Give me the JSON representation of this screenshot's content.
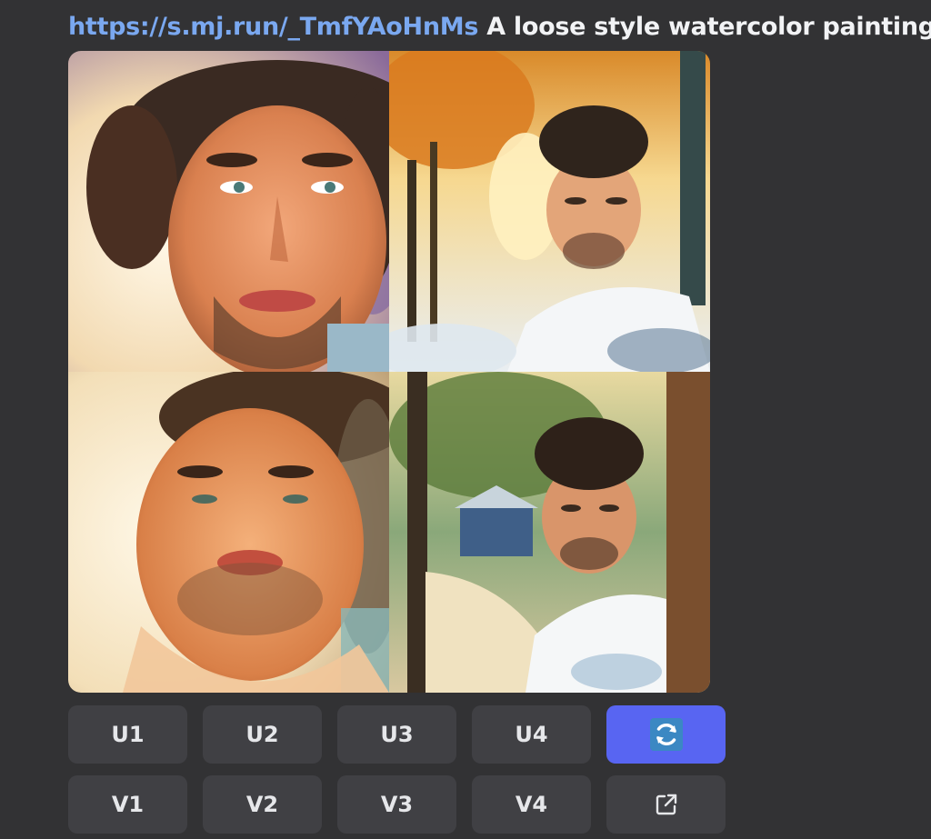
{
  "header": {
    "link_text": "https://s.mj.run/_TmfYAoHnMs",
    "prompt_text": " A loose style watercolor painting - "
  },
  "grid": {
    "images": [
      {
        "name": "watercolor-portrait-1",
        "icon": "portrait-image"
      },
      {
        "name": "watercolor-portrait-2",
        "icon": "portrait-image"
      },
      {
        "name": "watercolor-portrait-3",
        "icon": "portrait-image"
      },
      {
        "name": "watercolor-portrait-4",
        "icon": "portrait-image"
      }
    ]
  },
  "buttons": {
    "row1": [
      "U1",
      "U2",
      "U3",
      "U4"
    ],
    "row2": [
      "V1",
      "V2",
      "V3",
      "V4"
    ],
    "reroll_icon": "reroll-icon",
    "open_icon": "external-link-icon"
  },
  "colors": {
    "background": "#323234",
    "button": "#404044",
    "accent": "#5865f2",
    "link": "#7aa8f0"
  }
}
